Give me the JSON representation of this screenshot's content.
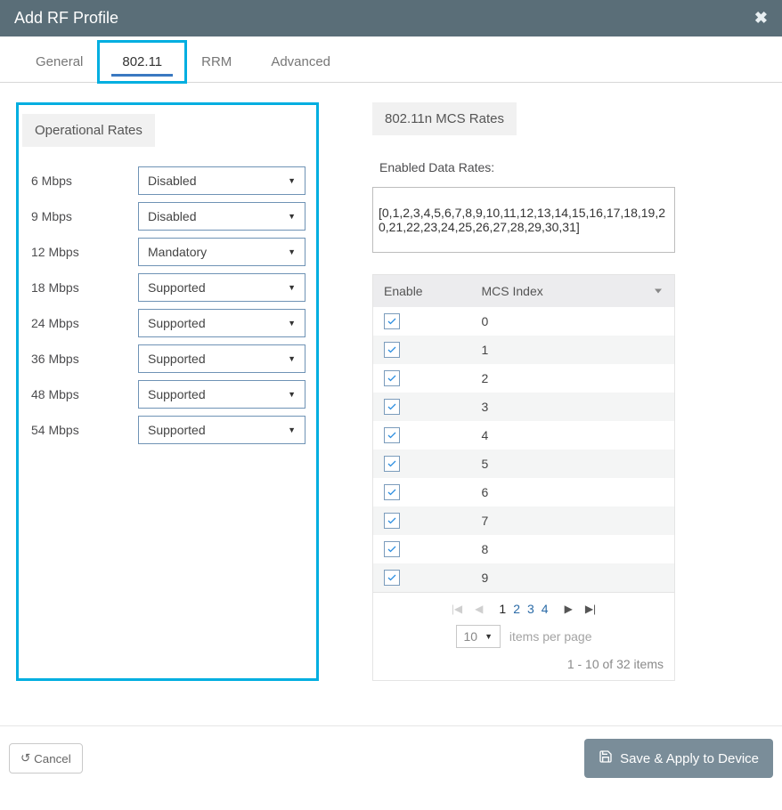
{
  "header": {
    "title": "Add RF Profile"
  },
  "tabs": [
    {
      "label": "General"
    },
    {
      "label": "802.11"
    },
    {
      "label": "RRM"
    },
    {
      "label": "Advanced"
    }
  ],
  "operational_rates": {
    "title": "Operational Rates",
    "rows": [
      {
        "label": "6 Mbps",
        "value": "Disabled"
      },
      {
        "label": "9 Mbps",
        "value": "Disabled"
      },
      {
        "label": "12 Mbps",
        "value": "Mandatory"
      },
      {
        "label": "18 Mbps",
        "value": "Supported"
      },
      {
        "label": "24 Mbps",
        "value": "Supported"
      },
      {
        "label": "36 Mbps",
        "value": "Supported"
      },
      {
        "label": "48 Mbps",
        "value": "Supported"
      },
      {
        "label": "54 Mbps",
        "value": "Supported"
      }
    ]
  },
  "mcs": {
    "title": "802.11n MCS Rates",
    "enabled_label": "Enabled Data Rates:",
    "enabled_text": "[0,1,2,3,4,5,6,7,8,9,10,11,12,13,14,15,16,17,18,19,20,21,22,23,24,25,26,27,28,29,30,31]",
    "col_enable": "Enable",
    "col_index": "MCS Index",
    "rows": [
      {
        "checked": true,
        "index": "0"
      },
      {
        "checked": true,
        "index": "1"
      },
      {
        "checked": true,
        "index": "2"
      },
      {
        "checked": true,
        "index": "3"
      },
      {
        "checked": true,
        "index": "4"
      },
      {
        "checked": true,
        "index": "5"
      },
      {
        "checked": true,
        "index": "6"
      },
      {
        "checked": true,
        "index": "7"
      },
      {
        "checked": true,
        "index": "8"
      },
      {
        "checked": true,
        "index": "9"
      }
    ],
    "pager": {
      "pages": [
        "1",
        "2",
        "3",
        "4"
      ],
      "current": "1",
      "ipp": "10",
      "ipp_label": "items per page",
      "range": "1 - 10 of 32 items"
    }
  },
  "footer": {
    "cancel": "Cancel",
    "save": "Save & Apply to Device"
  }
}
